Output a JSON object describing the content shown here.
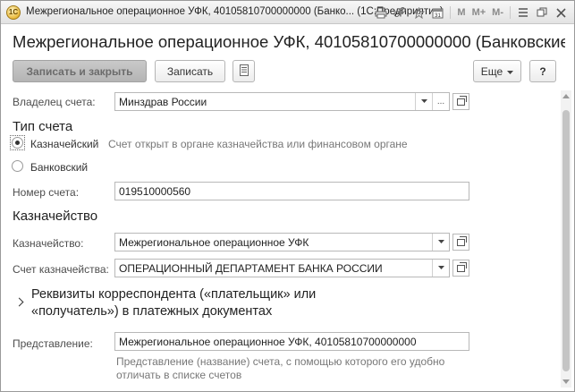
{
  "window": {
    "title": "Межрегиональное операционное УФК, 40105810700000000 (Банко... (1С:Предприятие)",
    "toolbar_icons": [
      "print-icon",
      "link-icon",
      "favorites-icon",
      "calendar-icon"
    ],
    "toolbar_text": {
      "m": "M",
      "m_plus": "M+",
      "m_minus": "M-"
    }
  },
  "form": {
    "title": "Межрегиональное операционное УФК, 40105810700000000 (Банковские ...",
    "buttons": {
      "save_close": "Записать и закрыть",
      "save": "Записать",
      "more": "Еще",
      "help": "?"
    },
    "owner": {
      "label": "Владелец счета:",
      "value": "Минздрав России",
      "ellipsis": "..."
    },
    "account_type": {
      "section": "Тип счета",
      "treasury": "Казначейский",
      "treasury_hint": "Счет открыт в органе казначейства или финансовом органе",
      "bank": "Банковский",
      "selected": "Казначейский"
    },
    "account_number": {
      "label": "Номер счета:",
      "value": "019510000560"
    },
    "treasury": {
      "section": "Казначейство",
      "treasury_label": "Казначейство:",
      "treasury_value": "Межрегиональное операционное УФК",
      "account_label": "Счет казначейства:",
      "account_value": "ОПЕРАЦИОННЫЙ ДЕПАРТАМЕНТ БАНКА РОССИИ"
    },
    "correspondent_group": {
      "title": "Реквизиты корреспондента («плательщик» или «получатель») в платежных документах"
    },
    "presentation": {
      "label": "Представление:",
      "value": "Межрегиональное операционное УФК, 40105810700000000",
      "hint": "Представление (название) счета, с помощью которого его удобно отличать в списке счетов"
    }
  },
  "colors": {
    "accent_button": "#b4b4b4",
    "title_bar": "#e3e3e3"
  }
}
